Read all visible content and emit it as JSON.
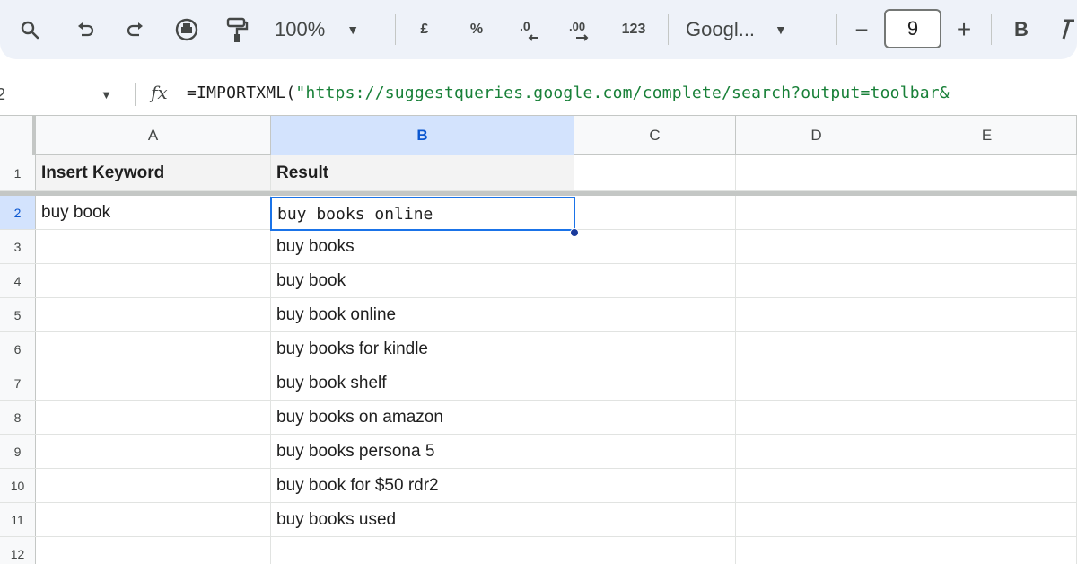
{
  "toolbar": {
    "zoom": "100%",
    "currency_symbol": "£",
    "percent_symbol": "%",
    "decimal_decrease": ".0",
    "decimal_increase": ".00",
    "number_format": "123",
    "font_name": "Googl...",
    "font_size": "9",
    "minus": "−",
    "plus": "+",
    "bold": "B"
  },
  "formula_bar": {
    "cell_ref": "2",
    "fx": "fx",
    "formula_prefix": "=IMPORTXML(",
    "formula_string": "\"https://suggestqueries.google.com/complete/search?output=toolbar&"
  },
  "columns": [
    "A",
    "B",
    "C",
    "D",
    "E"
  ],
  "selected_column": "B",
  "header_row": {
    "row_number": "1",
    "col_a": "Insert Keyword",
    "col_b": "Result"
  },
  "active_cell": {
    "row_number": "2",
    "col_a": "buy book",
    "value": "buy books online"
  },
  "rows": [
    {
      "num": "3",
      "b": "buy books"
    },
    {
      "num": "4",
      "b": "buy book"
    },
    {
      "num": "5",
      "b": "buy book online"
    },
    {
      "num": "6",
      "b": "buy books for kindle"
    },
    {
      "num": "7",
      "b": "buy book shelf"
    },
    {
      "num": "8",
      "b": "buy books on amazon"
    },
    {
      "num": "9",
      "b": "buy books persona 5"
    },
    {
      "num": "10",
      "b": "buy book for $50 rdr2"
    },
    {
      "num": "11",
      "b": "buy books used"
    },
    {
      "num": "12",
      "b": ""
    }
  ]
}
